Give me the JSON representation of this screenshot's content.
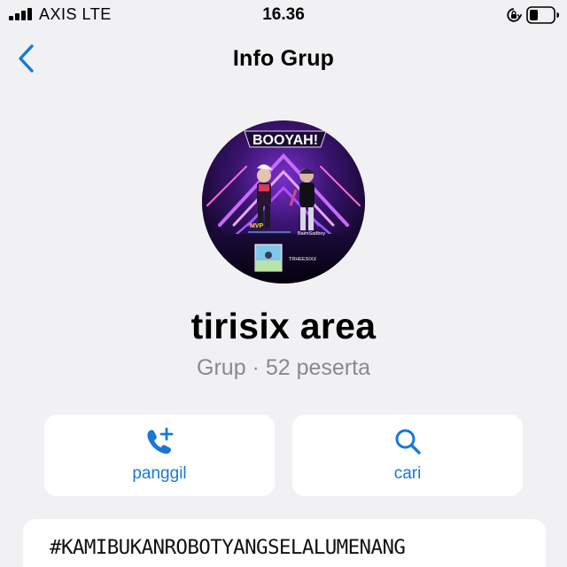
{
  "status_bar": {
    "carrier": "AXIS  LTE",
    "time": "16.36",
    "icons": [
      "signal-icon",
      "orientation-lock-icon",
      "battery-icon"
    ]
  },
  "nav": {
    "back_icon": "chevron-left-icon",
    "title": "Info Grup"
  },
  "group": {
    "avatar_caption": "BOOYAH!",
    "avatar_badge": "MVP",
    "avatar_player_right": "BaimSadboy",
    "avatar_player_bottom": "TRHEESIXX",
    "name": "tirisix area",
    "subtitle": "Grup · 52 peserta"
  },
  "actions": [
    {
      "label": "panggil",
      "icon": "phone-plus-icon"
    },
    {
      "label": "cari",
      "icon": "search-icon"
    }
  ],
  "description": {
    "text": "#KAMIBUKANROBOTYANGSELALUMENANG"
  },
  "colors": {
    "accent": "#1878d8",
    "background": "#f1f1f3",
    "card": "#ffffff",
    "secondary_text": "#8a8a8e"
  }
}
